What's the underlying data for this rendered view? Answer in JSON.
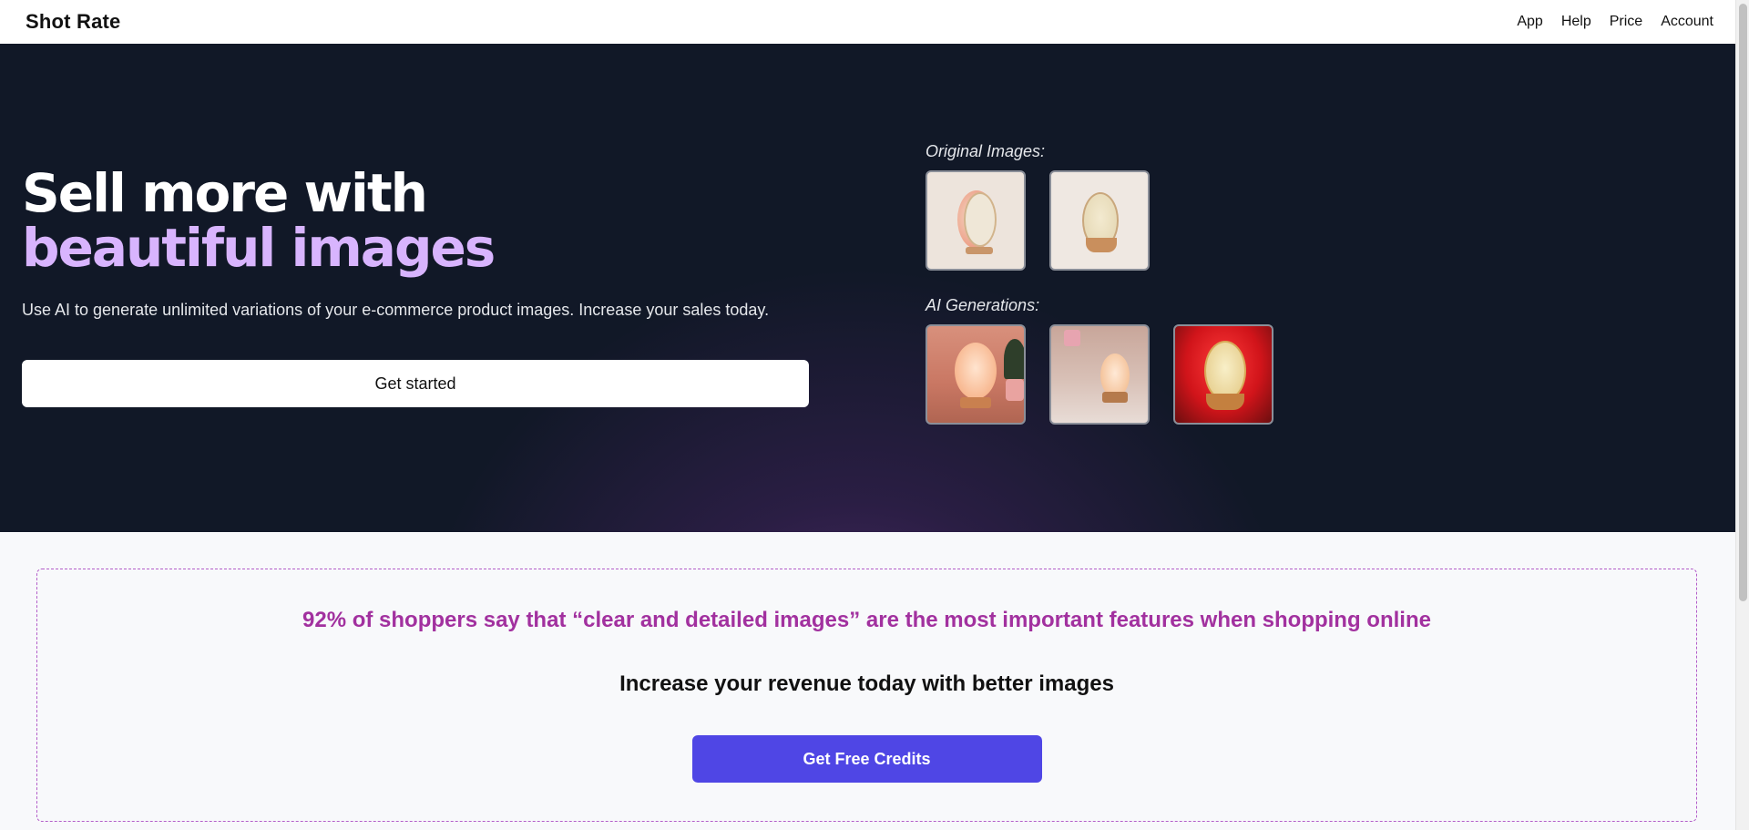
{
  "nav": {
    "brand": "Shot Rate",
    "links": [
      "App",
      "Help",
      "Price",
      "Account"
    ]
  },
  "hero": {
    "headline_line1": "Sell more with",
    "headline_line2": "beautiful images",
    "subtext": "Use AI to generate unlimited variations of your e-commerce product images. Increase your sales today.",
    "cta": "Get started",
    "original_label": "Original Images:",
    "ai_label": "AI Generations:",
    "colors": {
      "background": "#111827",
      "accent_text": "#d8b4fe"
    }
  },
  "callout": {
    "stat": "92% of shoppers say that “clear and detailed images” are the most important features when shopping online",
    "tagline": "Increase your revenue today with better images",
    "cta": "Get Free Credits",
    "colors": {
      "stat_text": "#a2319f",
      "button": "#4f46e5"
    }
  }
}
